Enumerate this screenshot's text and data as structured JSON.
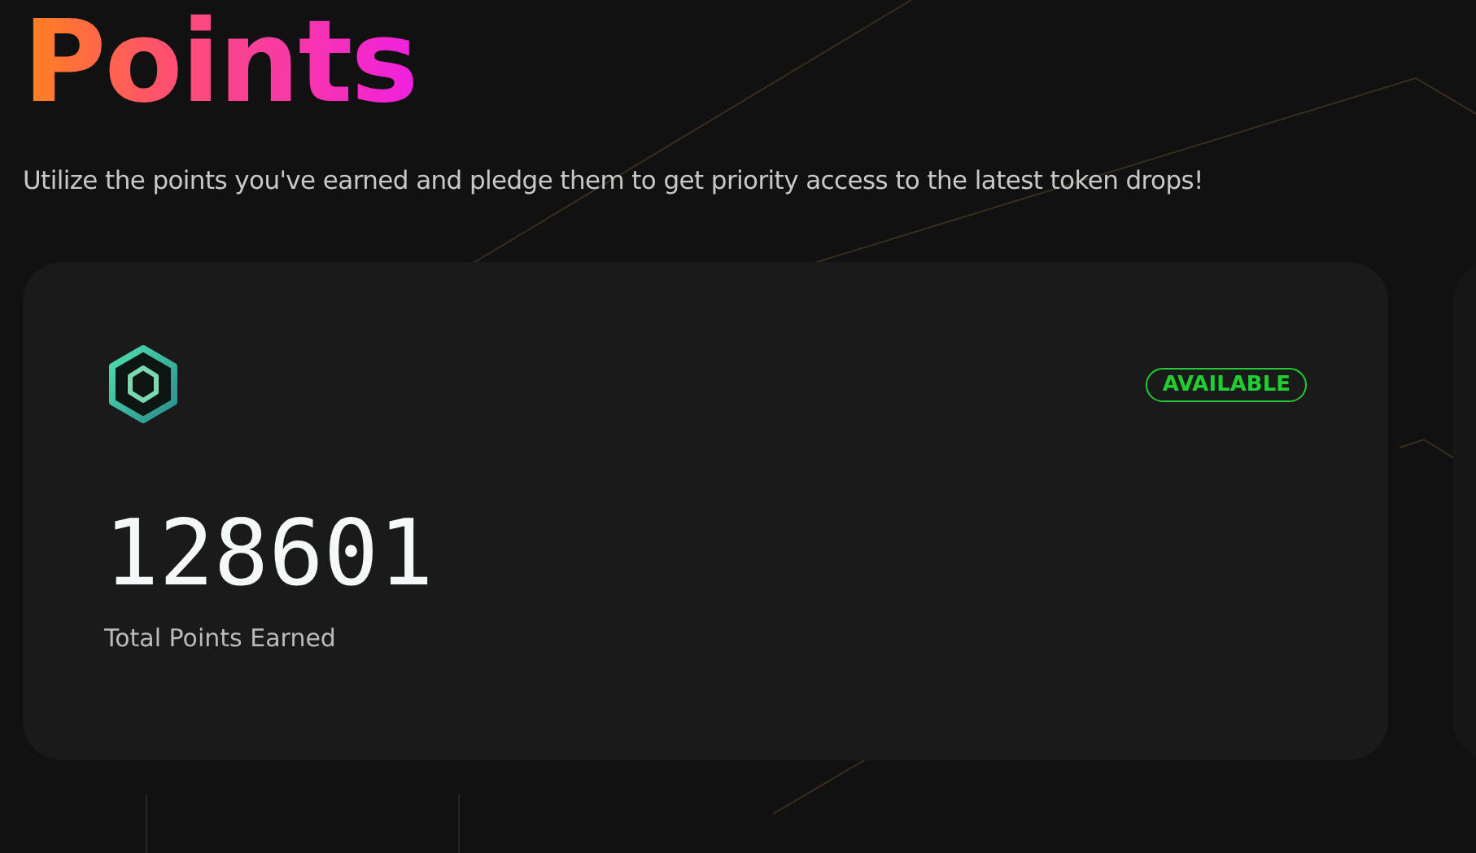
{
  "title": "Points",
  "subtitle": "Utilize the points you've earned and pledge them to get priority access to the latest token drops!",
  "card": {
    "status": {
      "label": "AVAILABLE",
      "kind": "available"
    },
    "value": "128601",
    "caption": "Total Points Earned"
  }
}
